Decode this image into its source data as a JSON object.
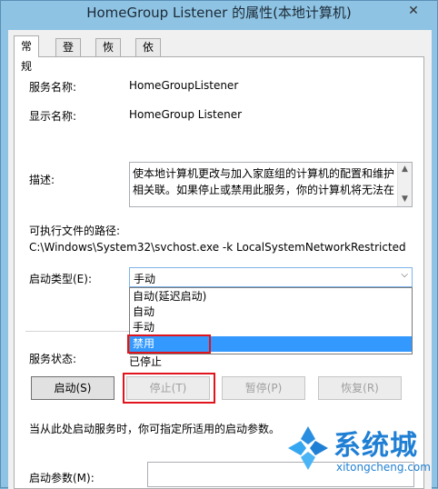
{
  "window": {
    "title": "HomeGroup Listener 的属性(本地计算机)",
    "close_glyph": "✕"
  },
  "tabs": [
    "常规",
    "登录",
    "恢复",
    "依存关系"
  ],
  "general": {
    "service_name_label": "服务名称:",
    "service_name": "HomeGroupListener",
    "display_name_label": "显示名称:",
    "display_name": "HomeGroup Listener",
    "description_label": "描述:",
    "description": "使本地计算机更改与加入家庭组的计算机的配置和维护相关联。如果停止或禁用此服务，你的计算机将无法在",
    "path_label": "可执行文件的路径:",
    "path": "C:\\Windows\\System32\\svchost.exe -k LocalSystemNetworkRestricted",
    "startup_type_label": "启动类型(E):",
    "startup_type_value": "手动",
    "startup_options": [
      "自动(延迟启动)",
      "自动",
      "手动",
      "禁用"
    ],
    "highlighted_option": "禁用",
    "status_label": "服务状态:",
    "status_value": "已停止",
    "buttons": {
      "start": "启动(S)",
      "stop": "停止(T)",
      "pause": "暂停(P)",
      "resume": "恢复(R)"
    },
    "hint": "当从此处启动服务时，你可指定所适用的启动参数。",
    "param_label": "启动参数(M):",
    "param_value": ""
  },
  "watermark": {
    "cn": "系统城",
    "en": "xitongcheng.com"
  },
  "colors": {
    "highlight": "#3399ff",
    "annotation_red": "#e0141c",
    "brand_blue": "#1f7fd4"
  }
}
